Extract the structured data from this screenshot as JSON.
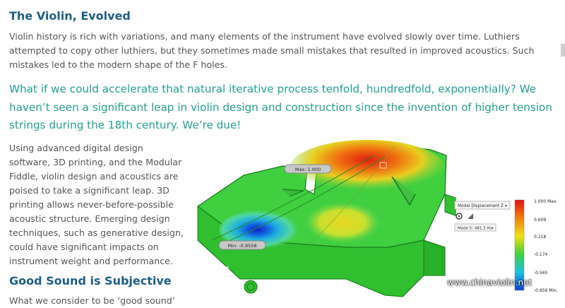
{
  "section1": {
    "title": "The Violin, Evolved",
    "body": "Violin history is rich with variations, and many elements of the instrument have evolved slowly over time. Luthiers attempted to copy other luthiers, but they sometimes made small mistakes that resulted in improved acoustics. Such mistakes led to the modern shape of the F holes."
  },
  "pullquote": "What if we could accelerate that natural iterative process tenfold, hundredfold, exponentially? We haven’t seen a significant leap in violin design and construction since the invention of higher tension strings during the 18th century. We’re due!",
  "section2": {
    "body": "Using advanced digital design software, 3D printing, and the Modular Fiddle, violin design and acoustics are poised to take a significant leap. 3D printing allows never-before-possible acoustic structure. Emerging design techniques, such as generative design, could have significant impacts on instrument weight and performance."
  },
  "section3": {
    "title": "Good Sound is Subjective",
    "body": "What we consider to be ‘good sound’"
  },
  "figure": {
    "max_label": "Max: 1.000",
    "min_label": "Min: -0.9558",
    "result_type": "Modal Displacement Z",
    "mode": "Mode 5: 481.3 Hz",
    "legend_ticks": [
      "1.000 Max.",
      "0.609",
      "0.218",
      "-0.174",
      "-0.565",
      "-0.956 Min."
    ],
    "gradient_colors": [
      "#e01010",
      "#f08010",
      "#f0e010",
      "#40d040",
      "#20c0e0",
      "#1040d0"
    ]
  },
  "watermark": "www.chinaviolin.net"
}
